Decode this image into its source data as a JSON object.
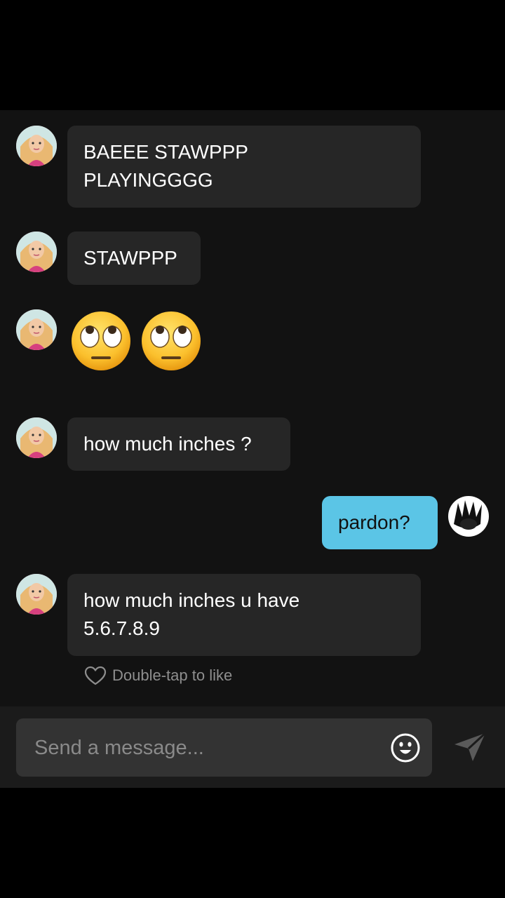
{
  "messages": [
    {
      "sender": "other",
      "text": "BAEEE STAWPPP\nPLAYINGGGG"
    },
    {
      "sender": "other",
      "text": "STAWPPP"
    },
    {
      "sender": "other",
      "emoji": [
        "face-with-rolling-eyes",
        "face-with-rolling-eyes"
      ]
    },
    {
      "sender": "other",
      "text": "how much inches ?"
    },
    {
      "sender": "me",
      "text": "pardon?"
    },
    {
      "sender": "other",
      "text": "how much inches u have\n5.6.7.8.9"
    }
  ],
  "like_hint": "Double-tap to like",
  "composer": {
    "placeholder": "Send a message...",
    "value": ""
  },
  "colors": {
    "background": "#000000",
    "chat_background": "#121212",
    "other_bubble": "#262626",
    "my_bubble": "#5bc5e6",
    "hint_text": "#8e8e8e"
  },
  "icons": [
    "emoji-icon",
    "send-icon",
    "heart-icon"
  ]
}
